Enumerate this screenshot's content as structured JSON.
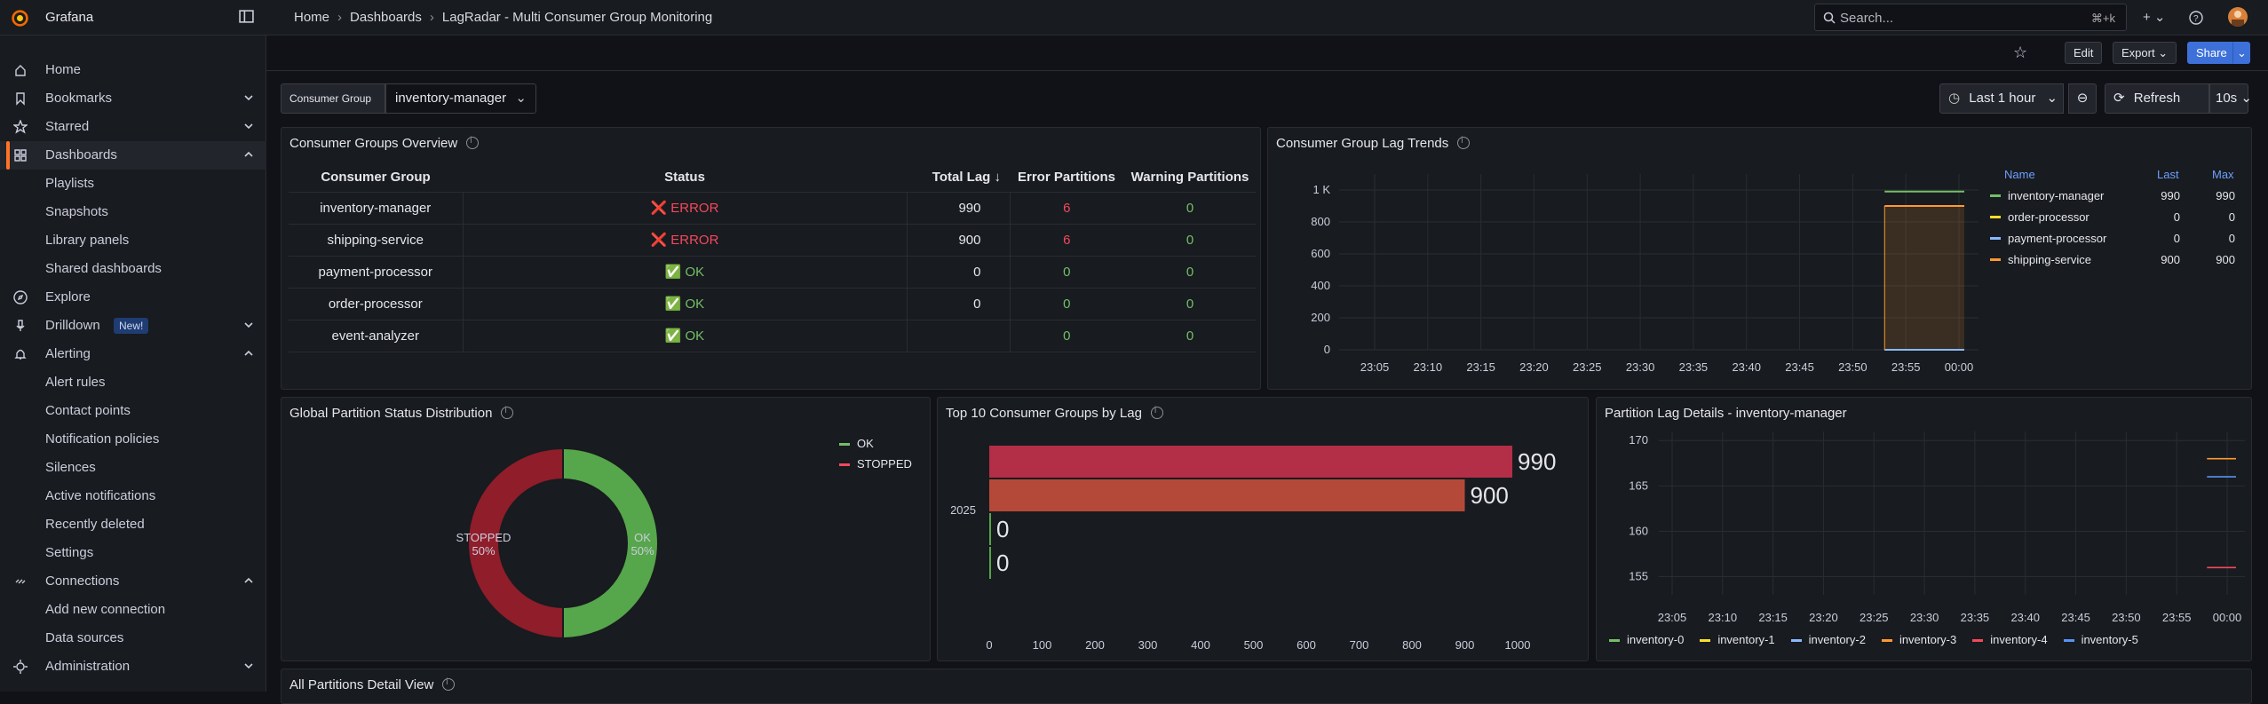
{
  "header": {
    "brand": "Grafana",
    "breadcrumbs": [
      "Home",
      "Dashboards",
      "LagRadar - Multi Consumer Group Monitoring"
    ],
    "search_placeholder": "Search...",
    "search_shortcut": "⌘+k"
  },
  "sidebar": {
    "items": [
      {
        "label": "Home",
        "icon": "home-icon"
      },
      {
        "label": "Bookmarks",
        "icon": "bookmark-icon",
        "chevron": "down"
      },
      {
        "label": "Starred",
        "icon": "star-icon",
        "chevron": "down"
      },
      {
        "label": "Dashboards",
        "icon": "apps-icon",
        "chevron": "up",
        "active": true
      },
      {
        "label": "Playlists",
        "sub": true
      },
      {
        "label": "Snapshots",
        "sub": true
      },
      {
        "label": "Library panels",
        "sub": true
      },
      {
        "label": "Shared dashboards",
        "sub": true
      },
      {
        "label": "Explore",
        "icon": "compass-icon"
      },
      {
        "label": "Drilldown",
        "icon": "microphone-icon",
        "chevron": "down",
        "badge": "New!"
      },
      {
        "label": "Alerting",
        "icon": "bell-icon",
        "chevron": "up"
      },
      {
        "label": "Alert rules",
        "sub": true
      },
      {
        "label": "Contact points",
        "sub": true
      },
      {
        "label": "Notification policies",
        "sub": true
      },
      {
        "label": "Silences",
        "sub": true
      },
      {
        "label": "Active notifications",
        "sub": true
      },
      {
        "label": "Recently deleted",
        "sub": true
      },
      {
        "label": "Settings",
        "sub": true
      },
      {
        "label": "Connections",
        "icon": "link-icon",
        "chevron": "up"
      },
      {
        "label": "Add new connection",
        "sub": true
      },
      {
        "label": "Data sources",
        "sub": true
      },
      {
        "label": "Administration",
        "icon": "cog-icon",
        "chevron": "down"
      }
    ]
  },
  "toolbar": {
    "edit": "Edit",
    "export": "Export",
    "share": "Share",
    "time_range": "Last 1 hour",
    "refresh": "Refresh",
    "refresh_interval": "10s"
  },
  "variable": {
    "label": "Consumer Group",
    "value": "inventory-manager"
  },
  "panels": {
    "overview": {
      "title": "Consumer Groups Overview",
      "columns": [
        "Consumer Group",
        "Status",
        "Total Lag",
        "Error Partitions",
        "Warning Partitions"
      ],
      "rows": [
        {
          "group": "inventory-manager",
          "status": "ERROR",
          "status_icon": "❌",
          "lag": "990",
          "errors": "6",
          "warnings": "0"
        },
        {
          "group": "shipping-service",
          "status": "ERROR",
          "status_icon": "❌",
          "lag": "900",
          "errors": "6",
          "warnings": "0"
        },
        {
          "group": "payment-processor",
          "status": "OK",
          "status_icon": "✅",
          "lag": "0",
          "errors": "0",
          "warnings": "0"
        },
        {
          "group": "order-processor",
          "status": "OK",
          "status_icon": "✅",
          "lag": "0",
          "errors": "0",
          "warnings": "0"
        },
        {
          "group": "event-analyzer",
          "status": "OK",
          "status_icon": "✅",
          "lag": "",
          "errors": "0",
          "warnings": "0"
        }
      ]
    },
    "trends": {
      "title": "Consumer Group Lag Trends",
      "legend_headers": [
        "Name",
        "Last",
        "Max"
      ],
      "legend": [
        {
          "name": "inventory-manager",
          "last": "990",
          "max": "990",
          "color": "#73bf69"
        },
        {
          "name": "order-processor",
          "last": "0",
          "max": "0",
          "color": "#fade2a"
        },
        {
          "name": "payment-processor",
          "last": "0",
          "max": "0",
          "color": "#8ab8ff"
        },
        {
          "name": "shipping-service",
          "last": "900",
          "max": "900",
          "color": "#ff9830"
        }
      ]
    },
    "distribution": {
      "title": "Global Partition Status Distribution",
      "legend": [
        {
          "name": "OK",
          "color": "#73bf69"
        },
        {
          "name": "STOPPED",
          "color": "#f2495c"
        }
      ],
      "labels": [
        {
          "name": "OK",
          "pct": "50%"
        },
        {
          "name": "STOPPED",
          "pct": "50%"
        }
      ]
    },
    "top10": {
      "title": "Top 10 Consumer Groups by Lag",
      "y_label": "2025",
      "value_labels": [
        "990",
        "900",
        "0",
        "0"
      ]
    },
    "details": {
      "title": "Partition Lag Details - inventory-manager",
      "legend": [
        {
          "name": "inventory-0",
          "color": "#73bf69"
        },
        {
          "name": "inventory-1",
          "color": "#fade2a"
        },
        {
          "name": "inventory-2",
          "color": "#8ab8ff"
        },
        {
          "name": "inventory-3",
          "color": "#ff9830"
        },
        {
          "name": "inventory-4",
          "color": "#f2495c"
        },
        {
          "name": "inventory-5",
          "color": "#5794f2"
        }
      ]
    },
    "partitions": {
      "title": "All Partitions Detail View"
    }
  },
  "chart_data": [
    {
      "type": "line",
      "title": "Consumer Group Lag Trends",
      "x": [
        "23:05",
        "23:10",
        "23:15",
        "23:20",
        "23:25",
        "23:30",
        "23:35",
        "23:40",
        "23:45",
        "23:50",
        "23:55",
        "00:00"
      ],
      "y_ticks": [
        "0",
        "200",
        "400",
        "600",
        "800",
        "1 K"
      ],
      "ylim": [
        0,
        1100
      ],
      "series": [
        {
          "name": "inventory-manager",
          "values": [
            null,
            null,
            null,
            null,
            null,
            null,
            null,
            null,
            null,
            null,
            990,
            990
          ]
        },
        {
          "name": "order-processor",
          "values": [
            null,
            null,
            null,
            null,
            null,
            null,
            null,
            null,
            null,
            null,
            0,
            0
          ]
        },
        {
          "name": "payment-processor",
          "values": [
            null,
            null,
            null,
            null,
            null,
            null,
            null,
            null,
            null,
            null,
            0,
            0
          ]
        },
        {
          "name": "shipping-service",
          "values": [
            null,
            null,
            null,
            null,
            null,
            null,
            null,
            null,
            null,
            null,
            900,
            900
          ]
        }
      ]
    },
    {
      "type": "pie",
      "title": "Global Partition Status Distribution",
      "categories": [
        "OK",
        "STOPPED"
      ],
      "values": [
        50,
        50
      ]
    },
    {
      "type": "bar",
      "title": "Top 10 Consumer Groups by Lag",
      "categories": [
        "2025"
      ],
      "values": [
        990,
        900,
        0,
        0
      ],
      "x_ticks": [
        "0",
        "100",
        "200",
        "300",
        "400",
        "500",
        "600",
        "700",
        "800",
        "900",
        "1000"
      ],
      "xlim": [
        0,
        1000
      ]
    },
    {
      "type": "line",
      "title": "Partition Lag Details - inventory-manager",
      "x": [
        "23:05",
        "23:10",
        "23:15",
        "23:20",
        "23:25",
        "23:30",
        "23:35",
        "23:40",
        "23:45",
        "23:50",
        "23:55",
        "00:00"
      ],
      "y_ticks": [
        "155",
        "160",
        "165",
        "170"
      ],
      "ylim": [
        153,
        171
      ],
      "series": [
        {
          "name": "inventory-3",
          "values": [
            168
          ]
        },
        {
          "name": "inventory-2",
          "values": [
            166
          ]
        },
        {
          "name": "inventory-4",
          "values": [
            156
          ]
        }
      ]
    }
  ]
}
